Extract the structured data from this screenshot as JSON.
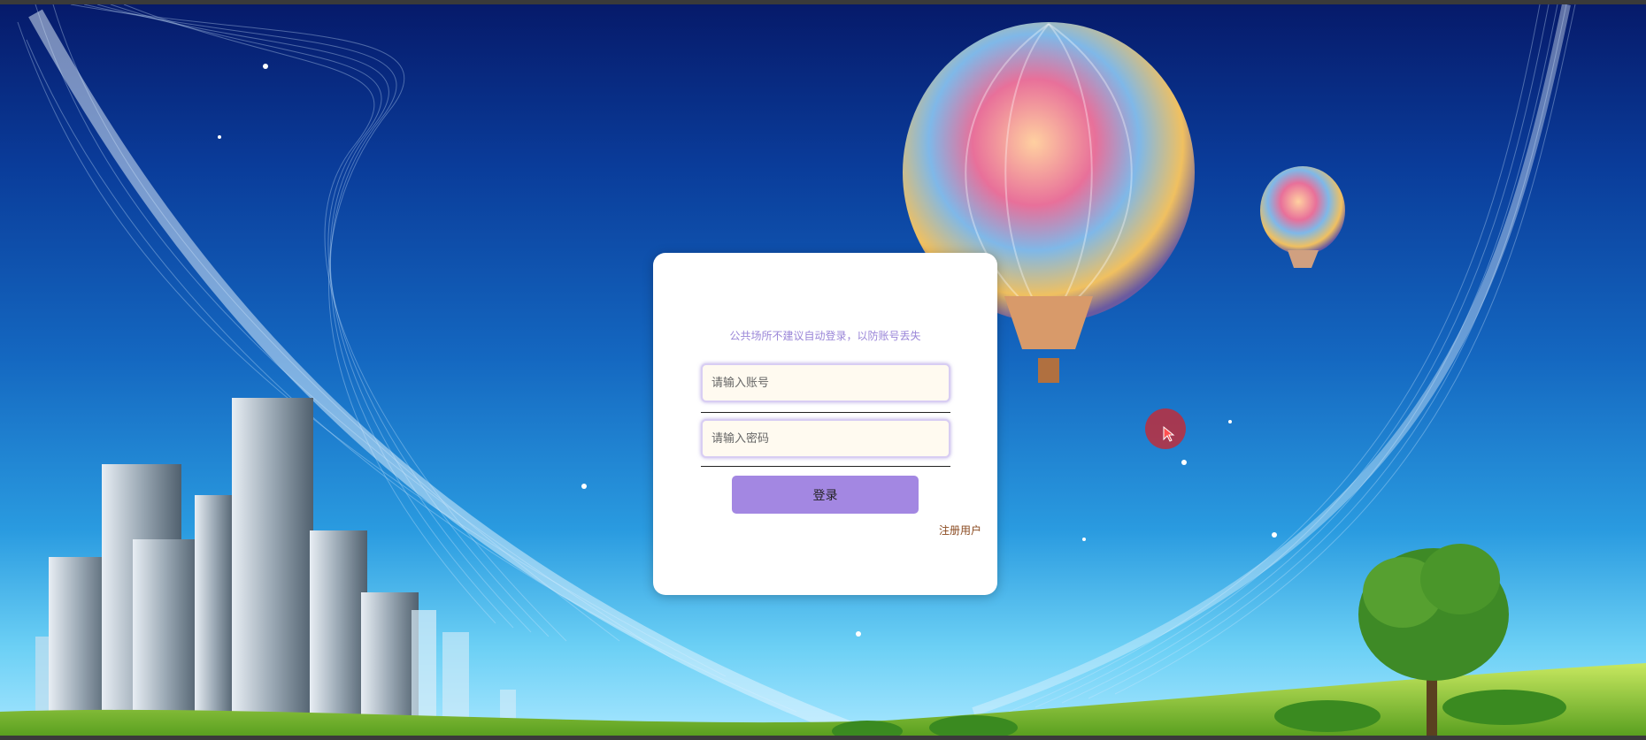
{
  "login": {
    "notice": "公共场所不建议自动登录，以防账号丢失",
    "account_placeholder": "请输入账号",
    "password_placeholder": "请输入密码",
    "login_label": "登录",
    "register_label": "注册用户"
  },
  "colors": {
    "accent": "#a387e2",
    "notice_text": "#9a86d8",
    "register_link": "#8a4a20"
  },
  "background": {
    "description_icons": [
      "wave-lines",
      "hot-air-balloon",
      "skyscrapers",
      "tree",
      "grass-hill"
    ]
  }
}
